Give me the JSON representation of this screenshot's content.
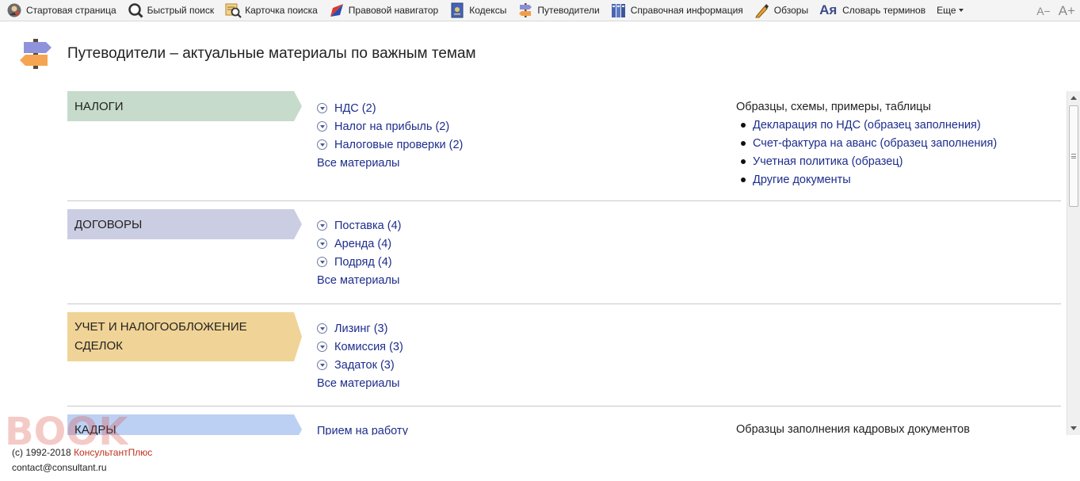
{
  "toolbar": {
    "items": [
      {
        "label": "Стартовая страница",
        "icon": "home-icon"
      },
      {
        "label": "Быстрый поиск",
        "icon": "search-icon"
      },
      {
        "label": "Карточка поиска",
        "icon": "search-card-icon"
      },
      {
        "label": "Правовой навигатор",
        "icon": "navigator-icon"
      },
      {
        "label": "Кодексы",
        "icon": "codex-icon"
      },
      {
        "label": "Путеводители",
        "icon": "signpost-icon"
      },
      {
        "label": "Справочная информация",
        "icon": "reference-icon"
      },
      {
        "label": "Обзоры",
        "icon": "reviews-icon"
      },
      {
        "label": "Словарь терминов",
        "icon": "dictionary-icon",
        "icon_text": "Aя"
      }
    ],
    "more_label": "Еще",
    "font_smaller": "A−",
    "font_bigger": "A+"
  },
  "header": {
    "title": "Путеводители – актуальные материалы по важным темам"
  },
  "sections": [
    {
      "name": "НАЛОГИ",
      "color": "#c6dbcb",
      "topics": [
        {
          "label": "НДС",
          "count": "(2)"
        },
        {
          "label": "Налог на прибыль",
          "count": "(2)"
        },
        {
          "label": "Налоговые проверки",
          "count": "(2)"
        }
      ],
      "all_label": "Все материалы",
      "samples_title": "Образцы, схемы, примеры, таблицы",
      "samples": [
        "Декларация по НДС (образец заполнения)",
        "Счет-фактура на аванс (образец заполнения)",
        "Учетная политика (образец)",
        "Другие документы"
      ]
    },
    {
      "name": "ДОГОВОРЫ",
      "color": "#cbcde2",
      "topics": [
        {
          "label": "Поставка",
          "count": "(4)"
        },
        {
          "label": "Аренда",
          "count": "(4)"
        },
        {
          "label": "Подряд",
          "count": "(4)"
        }
      ],
      "all_label": "Все материалы"
    },
    {
      "name": "УЧЕТ И НАЛОГООБЛОЖЕНИЕ СДЕЛОК",
      "color": "#f0d396",
      "topics": [
        {
          "label": "Лизинг",
          "count": "(3)"
        },
        {
          "label": "Комиссия",
          "count": "(3)"
        },
        {
          "label": "Задаток",
          "count": "(3)"
        }
      ],
      "all_label": "Все материалы"
    },
    {
      "name": "КАДРЫ",
      "color": "#bcd0f4",
      "topics": [
        {
          "label": "Прием на работу"
        }
      ],
      "samples_title": "Образцы заполнения кадровых документов"
    }
  ],
  "footer": {
    "copyright": "(c) 1992-2018",
    "brand": "КонсультантПлюс",
    "email": "contact@consultant.ru"
  },
  "watermark": {
    "text": "BOOK"
  }
}
